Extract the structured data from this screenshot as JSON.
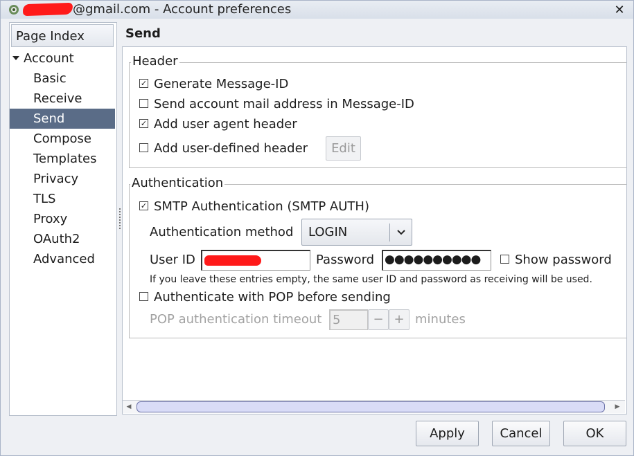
{
  "window": {
    "title": "@gmail.com - Account preferences",
    "close_icon": "close-icon",
    "app_icon": "mail-app-icon"
  },
  "sidebar": {
    "header": "Page Index",
    "root": "Account",
    "items": [
      {
        "label": "Basic"
      },
      {
        "label": "Receive"
      },
      {
        "label": "Send",
        "selected": true
      },
      {
        "label": "Compose"
      },
      {
        "label": "Templates"
      },
      {
        "label": "Privacy"
      },
      {
        "label": "TLS"
      },
      {
        "label": "Proxy"
      },
      {
        "label": "OAuth2"
      },
      {
        "label": "Advanced"
      }
    ]
  },
  "page": {
    "title": "Send"
  },
  "header_group": {
    "title": "Header",
    "generate_message_id": {
      "label": "Generate Message-ID",
      "checked": true
    },
    "send_account_address": {
      "label": "Send account mail address in Message-ID",
      "checked": false
    },
    "user_agent": {
      "label": "Add user agent header",
      "checked": true
    },
    "user_defined": {
      "label": "Add user-defined header",
      "checked": false
    },
    "edit_button": "Edit"
  },
  "auth_group": {
    "title": "Authentication",
    "smtp_auth": {
      "label": "SMTP Authentication (SMTP AUTH)",
      "checked": true
    },
    "method_label": "Authentication method",
    "method_value": "LOGIN",
    "user_id_label": "User ID",
    "password_label": "Password",
    "password_mask": "●●●●●●●●●●",
    "show_password": {
      "label": "Show password",
      "checked": false
    },
    "hint": "If you leave these entries empty, the same user ID and password as receiving will be used.",
    "pop_before_smtp": {
      "label": "Authenticate with POP before sending",
      "checked": false
    },
    "timeout_label": "POP authentication timeout",
    "timeout_value": "5",
    "timeout_unit": "minutes",
    "minus": "−",
    "plus": "+"
  },
  "buttons": {
    "apply": "Apply",
    "cancel": "Cancel",
    "ok": "OK"
  },
  "colors": {
    "selection": "#5a6c87",
    "redaction": "#ff1a1a"
  }
}
